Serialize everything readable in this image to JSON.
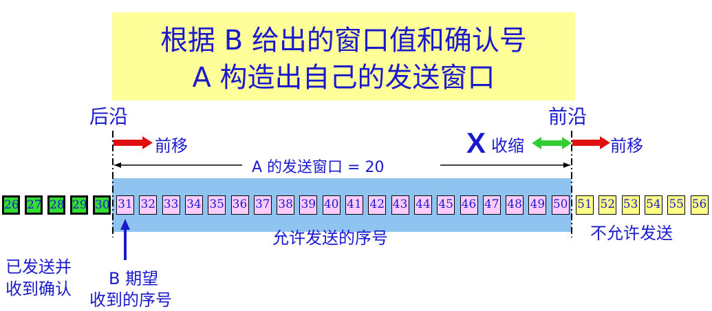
{
  "title": {
    "line1": "根据  B  给出的窗口值和确认号",
    "line2": "A  构造出自己的发送窗口"
  },
  "labels": {
    "trailing_edge": "后沿",
    "leading_edge": "前沿",
    "move_forward_left": "前移",
    "move_forward_right": "前移",
    "shrink": "收缩",
    "shrink_mark": "X",
    "window_size": "A  的发送窗口   = 20",
    "allowed_to_send": "允许发送的序号",
    "not_allowed": "不允许发送",
    "sent_acked_line1": "已发送并",
    "sent_acked_line2": "收到确认",
    "expected_line1": "B  期望",
    "expected_line2": "收到的序号"
  },
  "sequence": {
    "sent_acked": [
      "26",
      "27",
      "28",
      "29",
      "30"
    ],
    "window": [
      "31",
      "32",
      "33",
      "34",
      "35",
      "36",
      "37",
      "38",
      "39",
      "40",
      "41",
      "42",
      "43",
      "44",
      "45",
      "46",
      "47",
      "48",
      "49",
      "50"
    ],
    "not_allowed": [
      "51",
      "52",
      "53",
      "54",
      "55",
      "56"
    ]
  },
  "colors": {
    "sent_fill": "#33dd33",
    "window_band": "#8fc4f0",
    "window_cell": "#ffccff",
    "blocked_cell": "#ffff88",
    "text_blue": "#1a1acc",
    "arrow_red": "#e01010",
    "arrow_green": "#33cc33",
    "title_bg": "#ffff99"
  }
}
